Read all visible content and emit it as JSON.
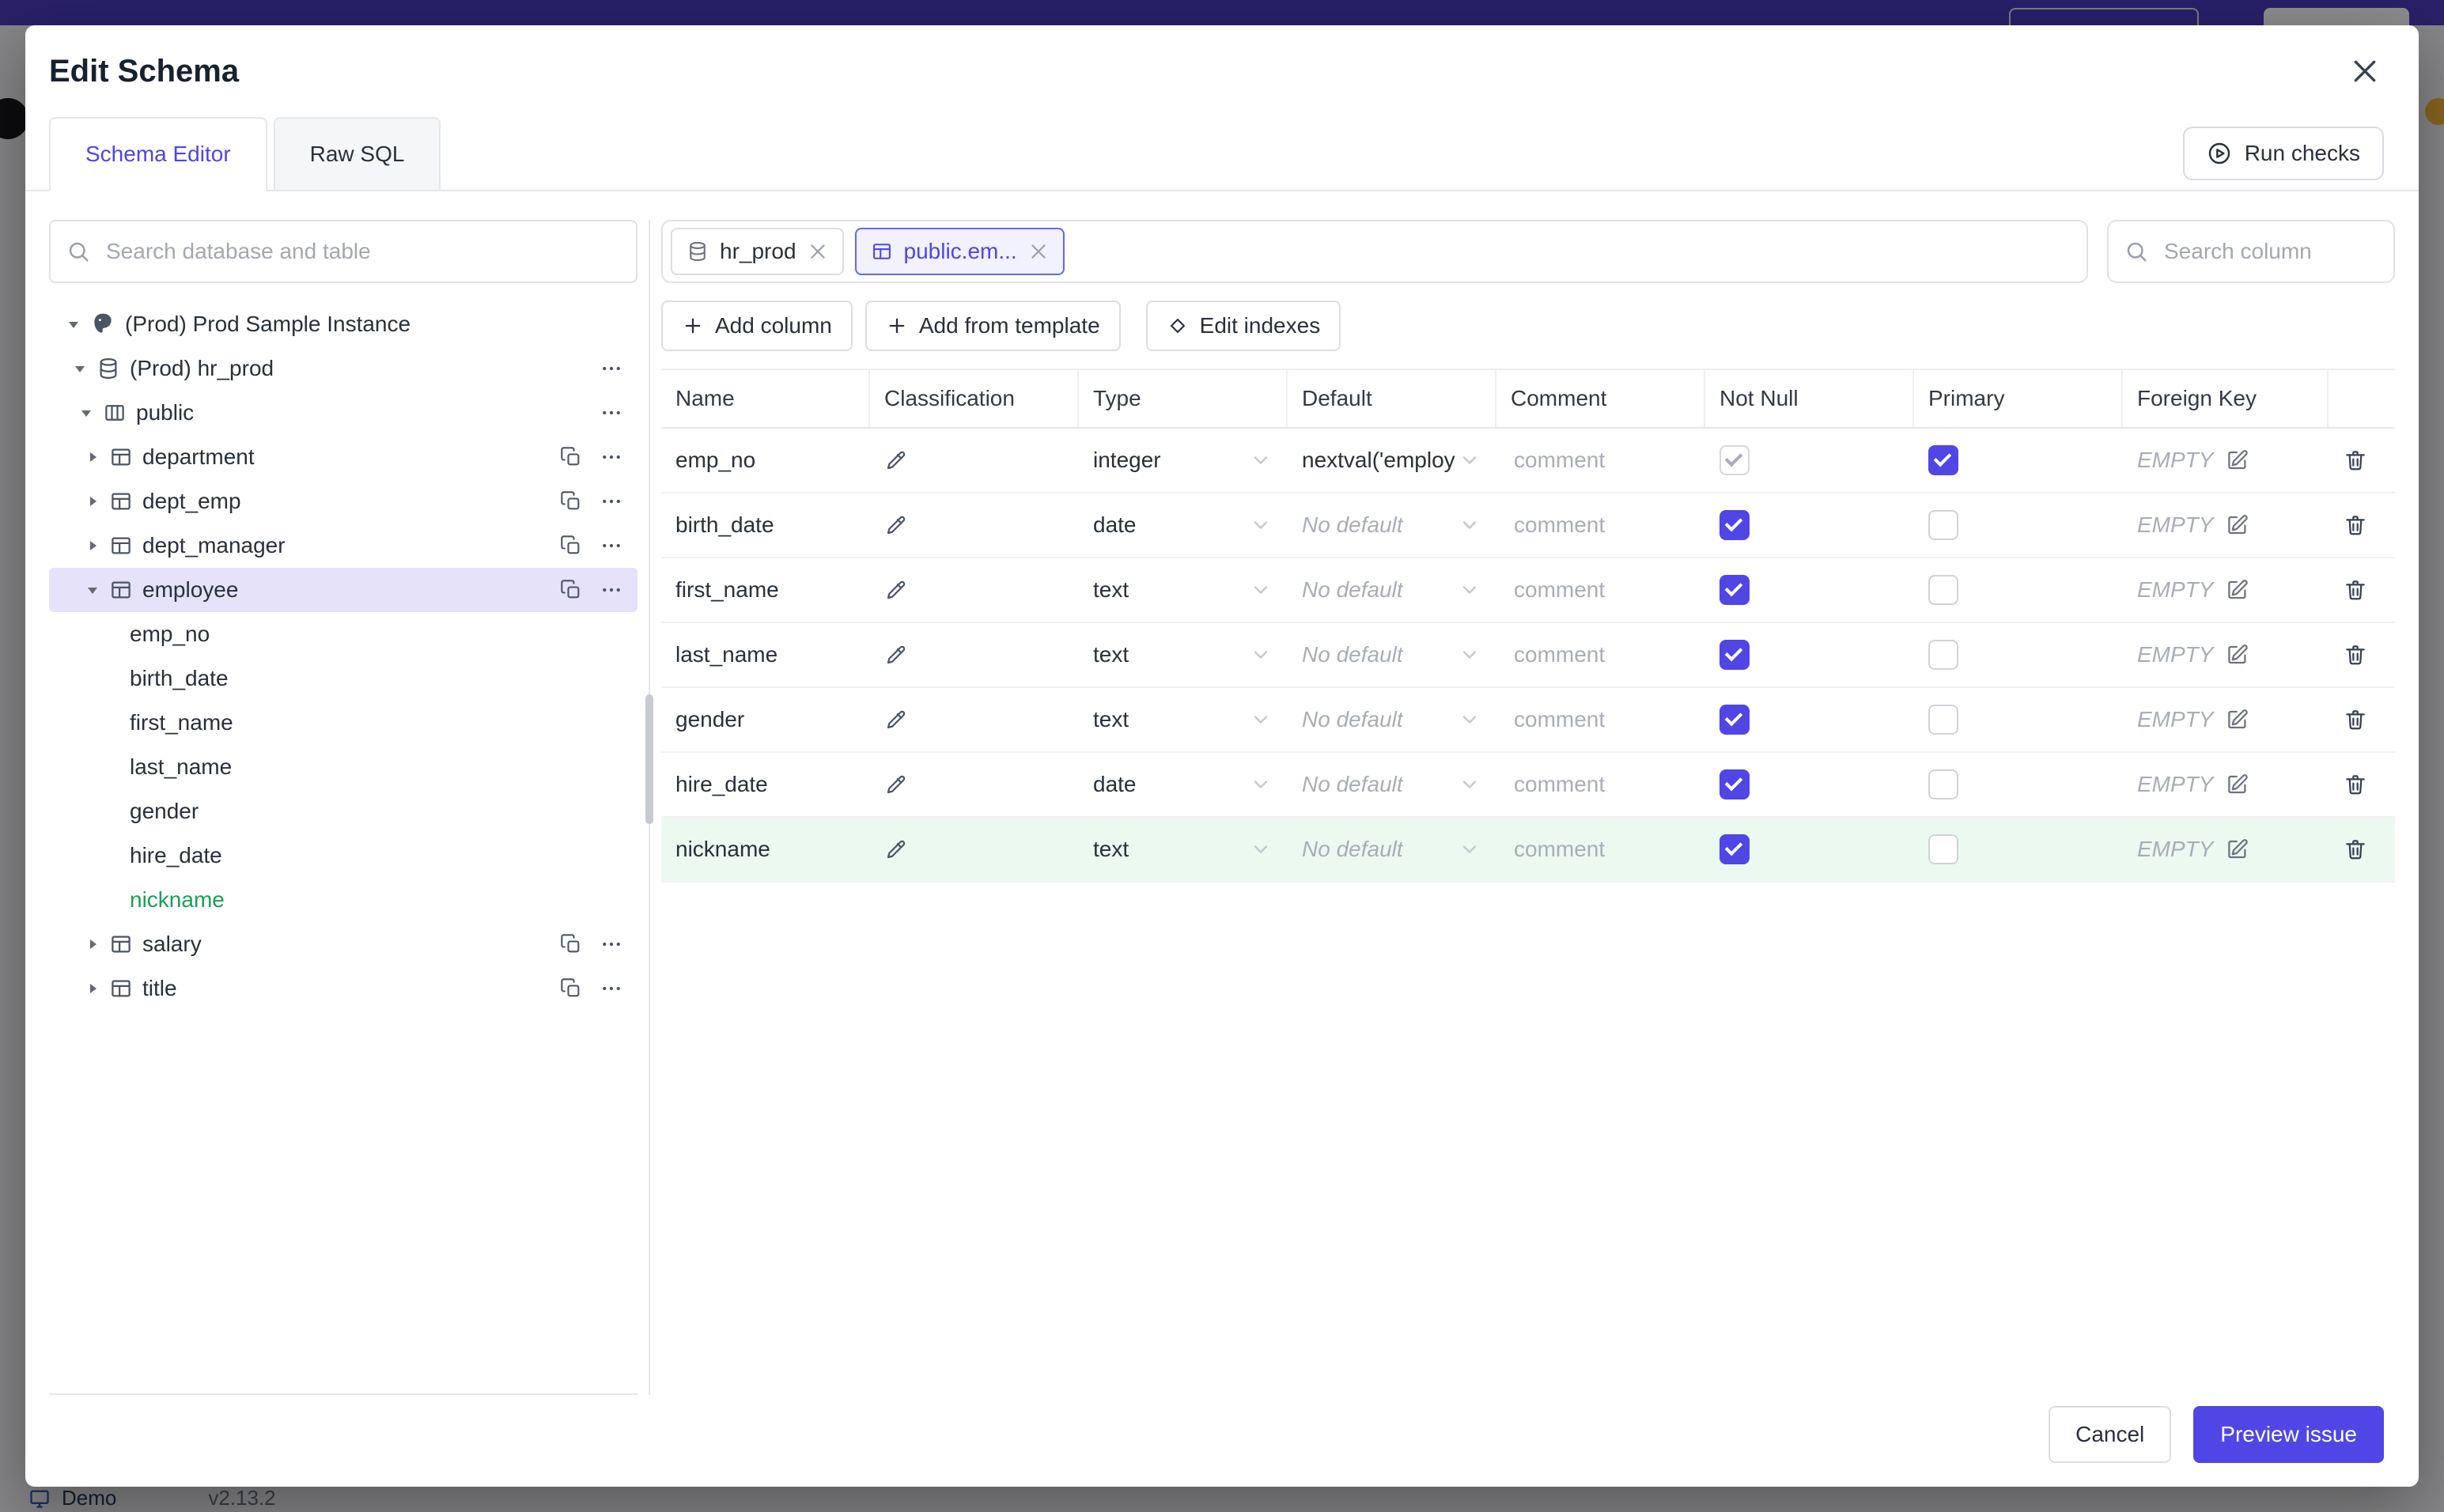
{
  "backdrop": {
    "demo_label": "Demo",
    "version": "v2.13.2"
  },
  "modal": {
    "title": "Edit Schema",
    "tabs": {
      "schema_editor": "Schema Editor",
      "raw_sql": "Raw SQL"
    },
    "run_checks_label": "Run checks",
    "footer": {
      "cancel_label": "Cancel",
      "preview_label": "Preview issue"
    }
  },
  "sidebar": {
    "search_placeholder": "Search database and table",
    "tree": {
      "instance_label": "(Prod) Prod Sample Instance",
      "database_label": "(Prod) hr_prod",
      "schema_label": "public",
      "tables_before": [
        "department",
        "dept_emp",
        "dept_manager"
      ],
      "selected_table": "employee",
      "columns": [
        "emp_no",
        "birth_date",
        "first_name",
        "last_name",
        "gender",
        "hire_date",
        "nickname"
      ],
      "tables_after": [
        "salary",
        "title"
      ]
    }
  },
  "main": {
    "chips": {
      "database_chip": "hr_prod",
      "table_chip": "public.em..."
    },
    "column_search_placeholder": "Search column",
    "toolbar": {
      "add_column": "Add column",
      "add_from_template": "Add from template",
      "edit_indexes": "Edit indexes"
    },
    "table": {
      "headers": [
        "Name",
        "Classification",
        "Type",
        "Default",
        "Comment",
        "Not Null",
        "Primary",
        "Foreign Key"
      ],
      "comment_placeholder": "comment",
      "empty_label": "EMPTY",
      "rows": [
        {
          "name": "emp_no",
          "type": "integer",
          "default": "nextval('employ"
        },
        {
          "name": "birth_date",
          "type": "date",
          "default": "No default"
        },
        {
          "name": "first_name",
          "type": "text",
          "default": "No default"
        },
        {
          "name": "last_name",
          "type": "text",
          "default": "No default"
        },
        {
          "name": "gender",
          "type": "text",
          "default": "No default"
        },
        {
          "name": "hire_date",
          "type": "date",
          "default": "No default"
        },
        {
          "name": "nickname",
          "type": "text",
          "default": "No default"
        }
      ]
    }
  }
}
